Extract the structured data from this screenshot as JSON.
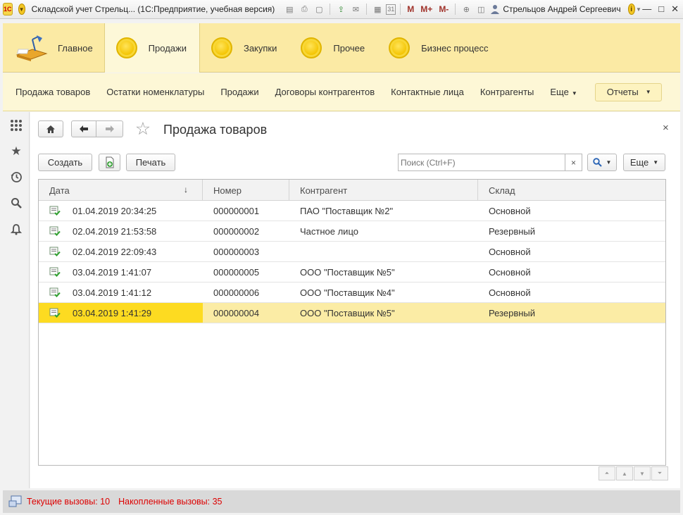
{
  "window": {
    "app_logo": "1С",
    "title": "Складской учет Стрельц...  (1С:Предприятие, учебная версия)",
    "user": "Стрельцов Андрей Сергеевич",
    "memory_buttons": [
      "M",
      "M+",
      "M-"
    ],
    "info_label": "i"
  },
  "sections": [
    {
      "label": "Главное",
      "icon": "desk-lamp-icon"
    },
    {
      "label": "Продажи",
      "icon": "coin-icon",
      "active": true
    },
    {
      "label": "Закупки",
      "icon": "coin-icon"
    },
    {
      "label": "Прочее",
      "icon": "coin-icon"
    },
    {
      "label": "Бизнес процесс",
      "icon": "coin-icon"
    }
  ],
  "function_panel": {
    "items": [
      "Продажа товаров",
      "Остатки номенклатуры",
      "Продажи",
      "Договоры контрагентов",
      "Контактные лица",
      "Контрагенты"
    ],
    "more_label": "Еще",
    "reports_label": "Отчеты"
  },
  "form": {
    "title": "Продажа товаров",
    "create_label": "Создать",
    "print_label": "Печать",
    "search_placeholder": "Поиск (Ctrl+F)",
    "more_label": "Еще",
    "close_glyph": "×"
  },
  "table": {
    "columns": [
      "Дата",
      "Номер",
      "Контрагент",
      "Склад"
    ],
    "sort_column": "Дата",
    "rows": [
      {
        "date": "01.04.2019 20:34:25",
        "number": "000000001",
        "counterparty": "ПАО \"Поставщик №2\"",
        "warehouse": "Основной",
        "selected": false
      },
      {
        "date": "02.04.2019 21:53:58",
        "number": "000000002",
        "counterparty": "Частное лицо",
        "warehouse": "Резервный",
        "selected": false
      },
      {
        "date": "02.04.2019 22:09:43",
        "number": "000000003",
        "counterparty": "",
        "warehouse": "Основной",
        "selected": false
      },
      {
        "date": "03.04.2019 1:41:07",
        "number": "000000005",
        "counterparty": "ООО \"Поставщик №5\"",
        "warehouse": "Основной",
        "selected": false
      },
      {
        "date": "03.04.2019 1:41:12",
        "number": "000000006",
        "counterparty": "ООО \"Поставщик №4\"",
        "warehouse": "Основной",
        "selected": false
      },
      {
        "date": "03.04.2019 1:41:29",
        "number": "000000004",
        "counterparty": "ООО \"Поставщик №5\"",
        "warehouse": "Резервный",
        "selected": true
      }
    ]
  },
  "status": {
    "current_calls": "Текущие вызовы: 10",
    "accumulated_calls": "Накопленные вызовы: 35"
  },
  "colors": {
    "section_bar": "#fbeaa4",
    "selected_row": "#fbeca5",
    "selected_cell": "#fddb21",
    "status_text": "#dd0000"
  }
}
